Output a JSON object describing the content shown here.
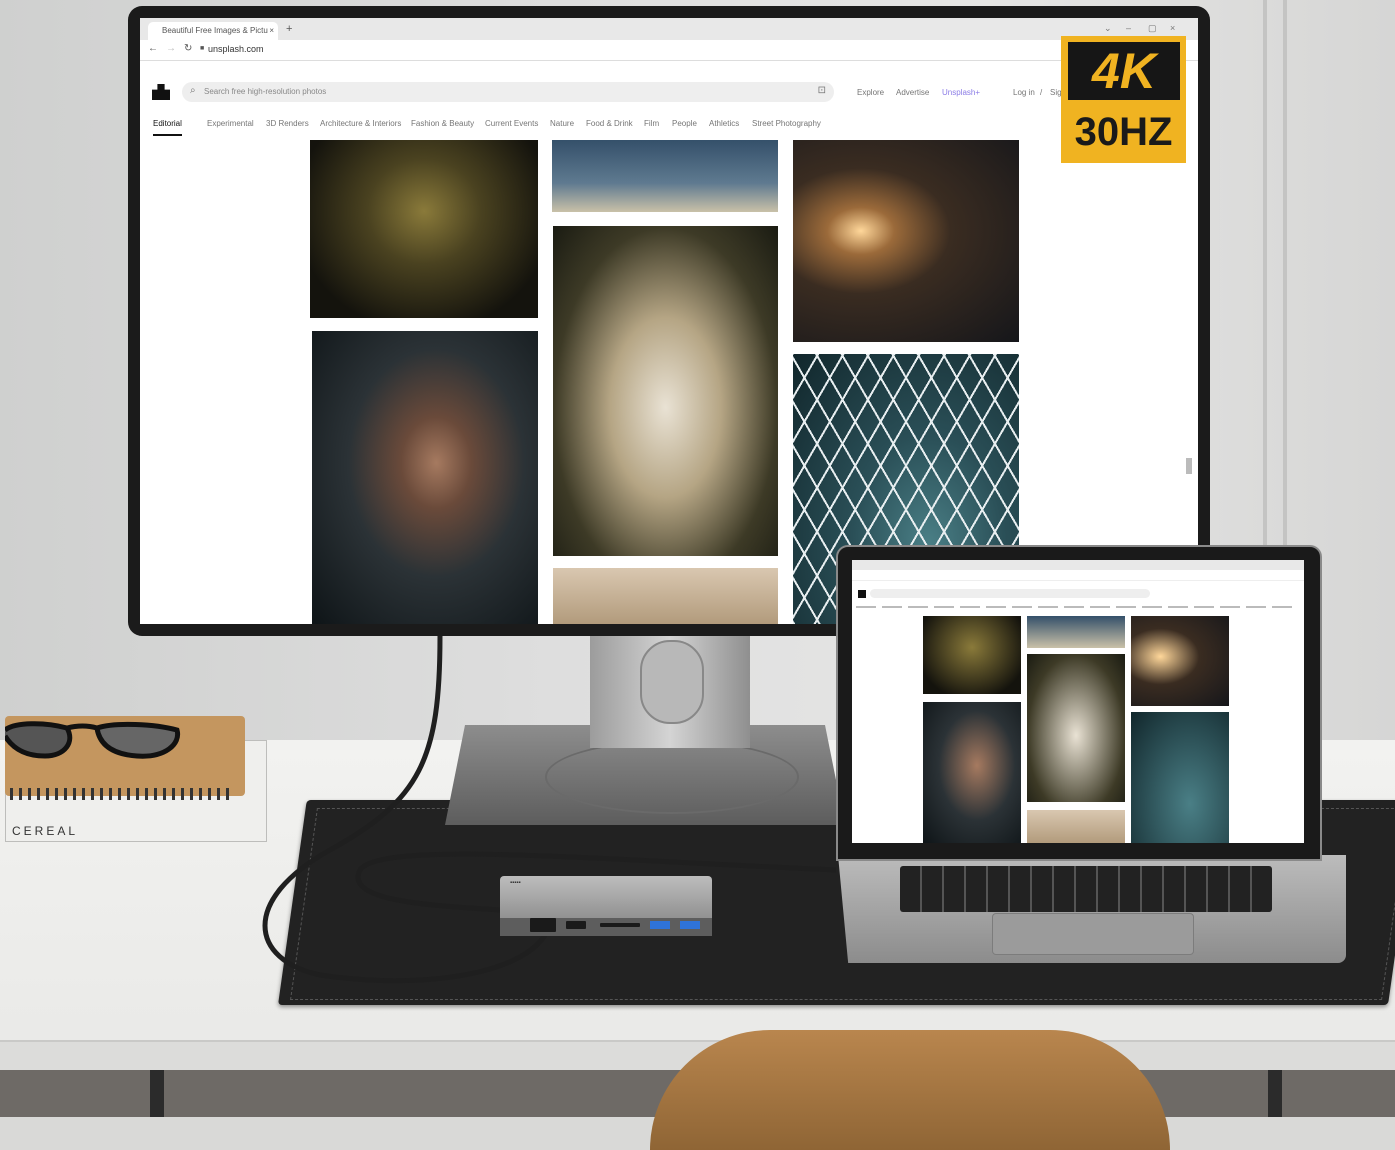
{
  "browser": {
    "tab_title": "Beautiful Free Images & Pictu",
    "tab_close": "×",
    "new_tab": "+",
    "url": "unsplash.com",
    "controls": [
      "⌄",
      "–",
      "▢",
      "×"
    ]
  },
  "site": {
    "search_placeholder": "Search free high-resolution photos",
    "nav": {
      "explore": "Explore",
      "advertise": "Advertise",
      "unsplash_plus": "Unsplash+",
      "login": "Log in",
      "slash": "/",
      "signup": "Sig"
    },
    "categories": [
      "Editorial",
      "Experimental",
      "3D Renders",
      "Architecture & Interiors",
      "Fashion & Beauty",
      "Current Events",
      "Nature",
      "Food & Drink",
      "Film",
      "People",
      "Athletics",
      "Street Photography"
    ]
  },
  "badge": {
    "resolution": "4K",
    "refresh": "30HZ",
    "color": "#f0b321"
  },
  "desk": {
    "book_spine": "CEREAL"
  },
  "icons": [
    "back-icon",
    "forward-icon",
    "reload-icon",
    "lock-icon",
    "search-icon",
    "visual-search-icon",
    "unsplash-logo-icon"
  ]
}
